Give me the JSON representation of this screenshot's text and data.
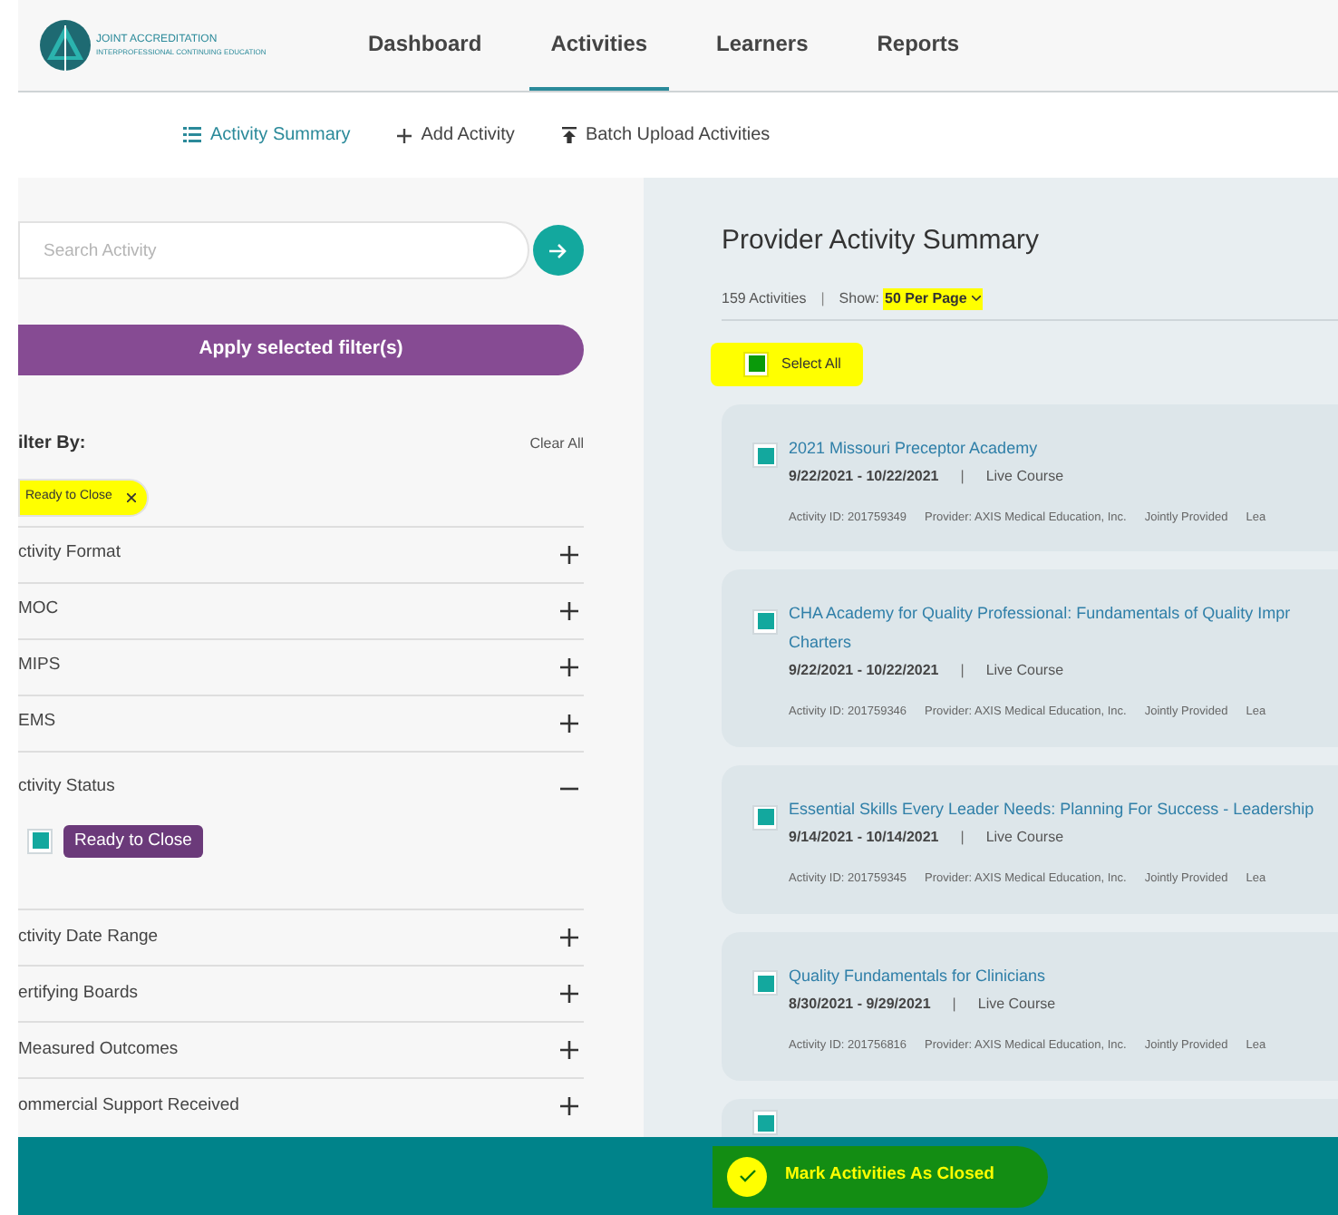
{
  "header": {
    "logo_text": "JOINT ACCREDITATION",
    "logo_subtext": "INTERPROFESSIONAL CONTINUING EDUCATION",
    "nav": [
      {
        "label": "Dashboard",
        "selected": false
      },
      {
        "label": "Activities",
        "selected": true
      },
      {
        "label": "Learners",
        "selected": false
      },
      {
        "label": "Reports",
        "selected": false
      }
    ]
  },
  "subnav": [
    {
      "kind": "list",
      "label": "Activity Summary",
      "selected": true
    },
    {
      "kind": "plus",
      "label": "Add Activity",
      "selected": false
    },
    {
      "kind": "upload",
      "label": "Batch Upload Activities",
      "selected": false
    }
  ],
  "filters": {
    "search": {
      "placeholder": "Search Activity"
    },
    "apply_button": "Apply selected filter(s)",
    "heading": "ilter By:",
    "clear_all": "Clear All",
    "chips": [
      {
        "label": "Ready to Close",
        "highlighted": true
      }
    ],
    "sections": [
      {
        "label": "ctivity Format",
        "expanded": false
      },
      {
        "label": "MOC",
        "expanded": false
      },
      {
        "label": "MIPS",
        "expanded": false
      },
      {
        "label": "EMS",
        "expanded": false
      },
      {
        "label": "ctivity Status",
        "expanded": true,
        "options": [
          {
            "label": "Ready to Close",
            "checked": true
          }
        ]
      },
      {
        "label": "ctivity Date Range",
        "expanded": false
      },
      {
        "label": "ertifying Boards",
        "expanded": false
      },
      {
        "label": "Measured Outcomes",
        "expanded": false
      },
      {
        "label": "ommercial Support Received",
        "expanded": false
      }
    ]
  },
  "summary": {
    "title": "Provider Activity Summary",
    "count": "159 Activities",
    "separator": "|",
    "show_label": "Show:",
    "per_page": {
      "value": "50 Per Page",
      "highlighted": true
    },
    "select_all": {
      "label": "Select All",
      "checked": true,
      "highlighted": true
    },
    "activities": [
      {
        "title": "2021 Missouri Preceptor Academy",
        "checked": true,
        "dates": "9/22/2021 - 10/22/2021",
        "separator": "|",
        "format": "Live Course",
        "meta": [
          "Activity ID: 201759349",
          "Provider: AXIS Medical Education, Inc.",
          "Jointly Provided",
          "Lea"
        ]
      },
      {
        "title": "CHA Academy for Quality Professional: Fundamentals of Quality Impr",
        "title_continued": "Charters",
        "checked": true,
        "dates": "9/22/2021 - 10/22/2021",
        "separator": "|",
        "format": "Live Course",
        "meta": [
          "Activity ID: 201759346",
          "Provider: AXIS Medical Education, Inc.",
          "Jointly Provided",
          "Lea"
        ]
      },
      {
        "title": "Essential Skills Every Leader Needs: Planning For Success - Leadership",
        "checked": true,
        "dates": "9/14/2021 - 10/14/2021",
        "separator": "|",
        "format": "Live Course",
        "meta": [
          "Activity ID: 201759345",
          "Provider: AXIS Medical Education, Inc.",
          "Jointly Provided",
          "Lea"
        ]
      },
      {
        "title": "Quality Fundamentals for Clinicians",
        "checked": true,
        "dates": "8/30/2021 - 9/29/2021",
        "separator": "|",
        "format": "Live Course",
        "meta": [
          "Activity ID: 201756816",
          "Provider: AXIS Medical Education, Inc.",
          "Jointly Provided",
          "Lea"
        ]
      },
      {
        "checked": true
      }
    ]
  },
  "action_bar": {
    "label": "Mark Activities As Closed",
    "highlighted": true
  }
}
